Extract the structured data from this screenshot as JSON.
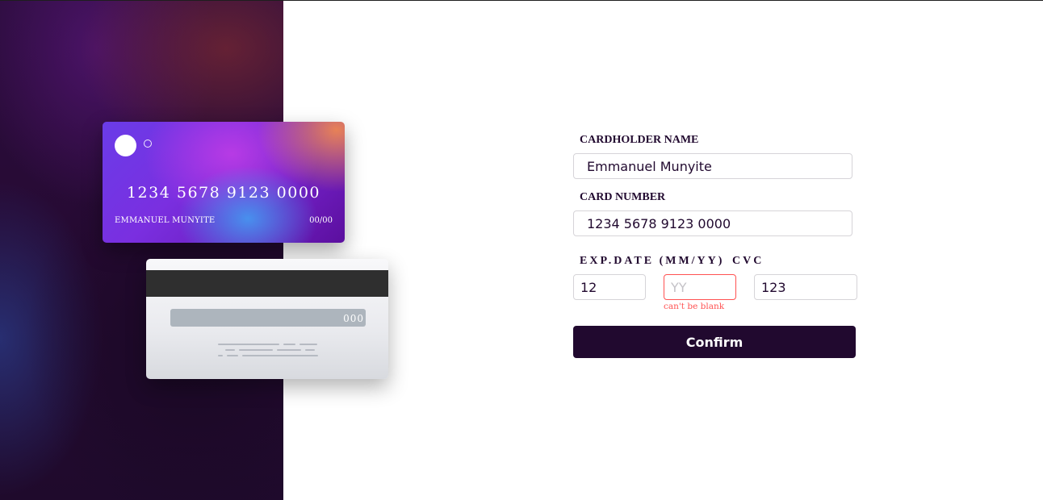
{
  "card_front": {
    "number": "1234 5678 9123 0000",
    "holder": "EMMANUEL MUNYITE",
    "expiry": "00/00"
  },
  "card_back": {
    "cvc": "000"
  },
  "form": {
    "cardholder_label": "CARDHOLDER NAME",
    "cardholder_value": "Emmanuel Munyite",
    "card_number_label": "CARD NUMBER",
    "card_number_value": "1234 5678 9123 0000",
    "exp_label": "EXP.DATE (MM/YY)",
    "cvc_label": "CVC",
    "month_value": "12",
    "year_value": "",
    "year_placeholder": "YY",
    "cvc_value": "123",
    "year_error": "can't be blank",
    "confirm_label": "Confirm"
  },
  "colors": {
    "dark_violet": "#21092f",
    "error_red": "#ff5252",
    "input_border": "#d6d4d8"
  }
}
